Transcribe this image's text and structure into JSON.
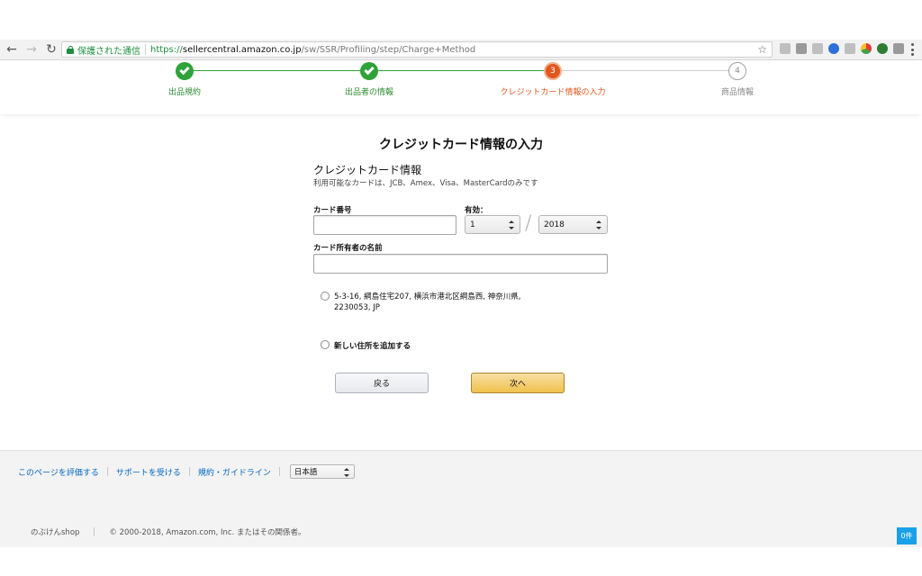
{
  "browser": {
    "secure_label": "保護された通信",
    "url_scheme": "https://",
    "url_host": "sellercentral.amazon.co.jp",
    "url_path": "/sw/SSR/Profiling/step/Charge+Method",
    "icons": [
      "back-arrow-icon",
      "forward-arrow-icon",
      "reload-icon",
      "lock-icon",
      "star-icon"
    ]
  },
  "stepper": {
    "steps": [
      {
        "label": "出品規約",
        "state": "done",
        "number": ""
      },
      {
        "label": "出品者の情報",
        "state": "done",
        "number": ""
      },
      {
        "label": "クレジットカード情報の入力",
        "state": "current",
        "number": "3"
      },
      {
        "label": "商品情報",
        "state": "future",
        "number": "4"
      }
    ],
    "colors": {
      "done": "#2fa23a",
      "current": "#e1581f",
      "future": "#888888"
    }
  },
  "form": {
    "page_title": "クレジットカード情報の入力",
    "section_title": "クレジットカード情報",
    "section_subtitle": "利用可能なカードは、JCB、Amex、Visa、MasterCardのみです",
    "card_number_label": "カード番号",
    "card_number_value": "",
    "expiry_label": "有効：",
    "expiry_month": "1",
    "expiry_year": "2018",
    "holder_name_label": "カード所有者の名前",
    "holder_name_value": "",
    "address_line1": "5-3-16, 綱島住宅207, 横浜市港北区綱島西, 神奈川県,",
    "address_line2": "2230053, JP",
    "new_address_label": "新しい住所を追加する",
    "back_button": "戻る",
    "next_button": "次へ"
  },
  "footer": {
    "rate_page": "このページを評価する",
    "get_support": "サポートを受ける",
    "policies": "規約・ガイドライン",
    "language": "日本語",
    "shop_name": "のぶけんshop",
    "copyright": "© 2000-2018, Amazon.com, Inc. またはその関係者。",
    "count_badge": "0件"
  }
}
